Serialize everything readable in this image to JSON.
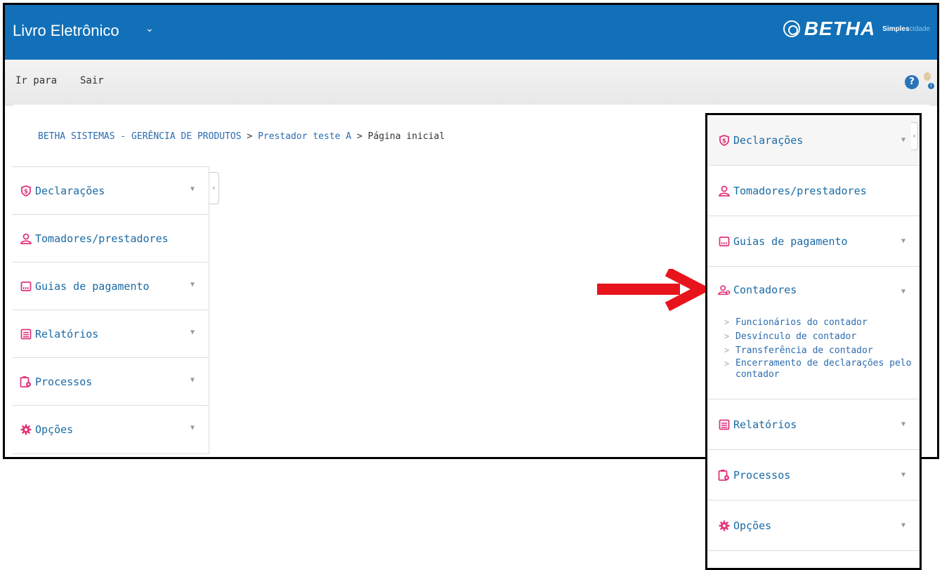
{
  "app": {
    "title": "Livro Eletrônico",
    "title_caret": "⌄",
    "logo_text": "BETHA",
    "logo_sub_a": "Simples",
    "logo_sub_b": "cidade"
  },
  "nav": {
    "go_to": "Ir para",
    "exit": "Sair",
    "help_glyph": "?",
    "user_badge": "i"
  },
  "breadcrumb": {
    "org": "BETHA SISTEMAS - GERÊNCIA DE PRODUTOS",
    "sep1": " > ",
    "provider": "Prestador teste A",
    "sep2": " > ",
    "current": "Página inicial"
  },
  "menu": {
    "items": [
      {
        "label": "Declarações",
        "icon": "dollar-shield-icon",
        "has_arrow": true
      },
      {
        "label": "Tomadores/prestadores",
        "icon": "user-icon",
        "has_arrow": false
      },
      {
        "label": "Guias de pagamento",
        "icon": "payment-slip-icon",
        "has_arrow": true
      },
      {
        "label": "Relatórios",
        "icon": "report-icon",
        "has_arrow": true
      },
      {
        "label": "Processos",
        "icon": "clipboard-gear-icon",
        "has_arrow": true
      },
      {
        "label": "Opções",
        "icon": "gear-icon",
        "has_arrow": true
      }
    ],
    "arrow_glyph": "▼",
    "collapse_glyph": "‹"
  },
  "right_menu": {
    "declaracoes": "Declarações",
    "tomadores": "Tomadores/prestadores",
    "guias": "Guias de pagamento",
    "contadores": "Contadores",
    "contadores_sub": [
      "Funcionários do contador",
      "Desvínculo de contador",
      "Transferência de contador",
      "Encerramento de declarações pelo contador"
    ],
    "relatorios": "Relatórios",
    "processos": "Processos",
    "opcoes": "Opções"
  },
  "colors": {
    "header": "#1170b8",
    "link": "#1a6aa5",
    "icon_pink": "#e0357a",
    "annotation_arrow": "#e8141c"
  }
}
